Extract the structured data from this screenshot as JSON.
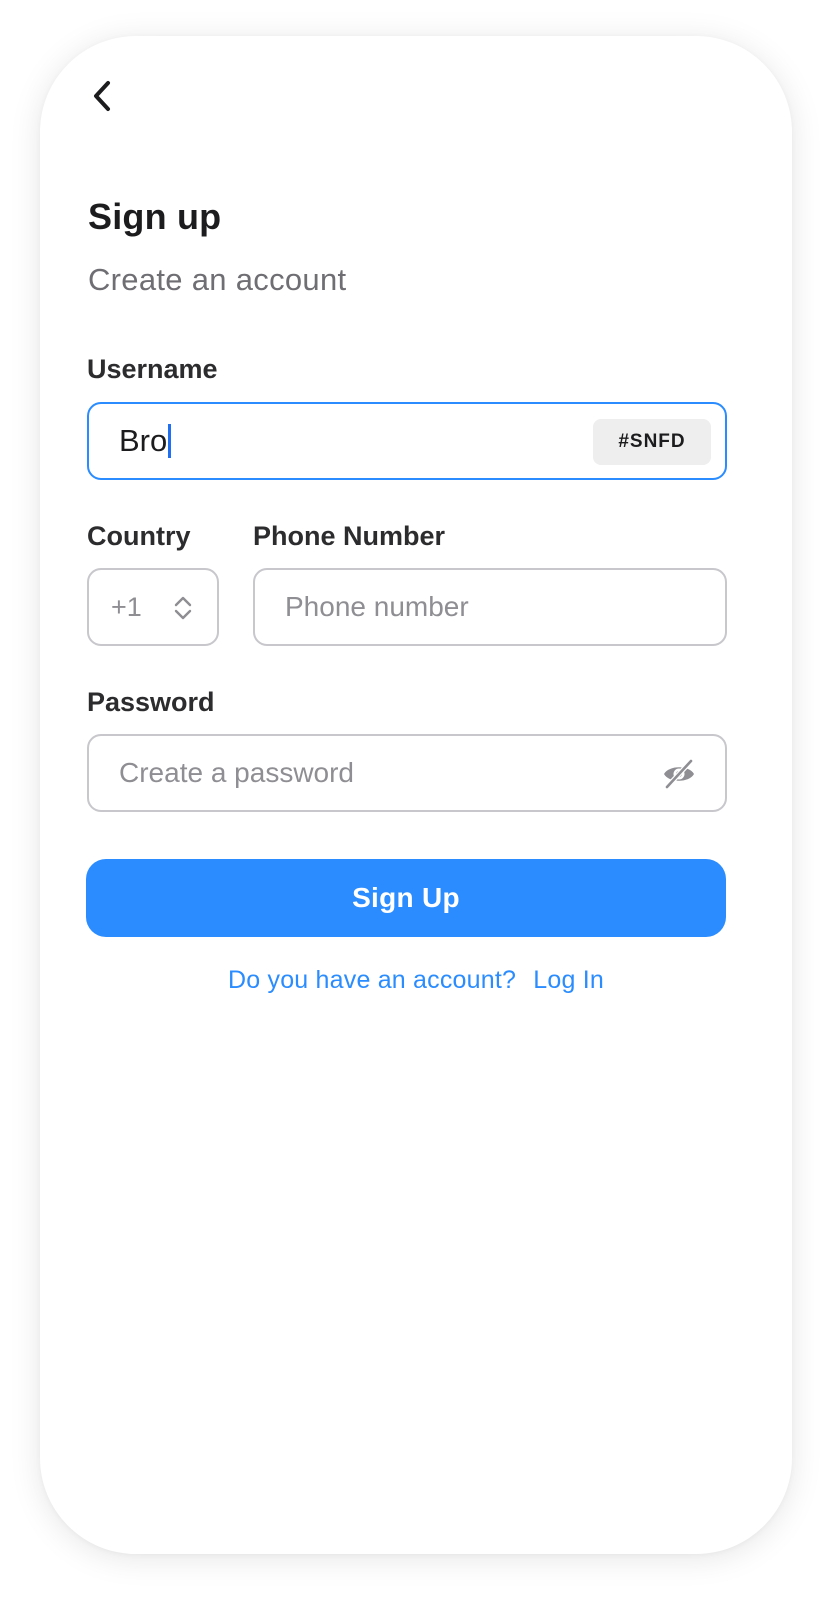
{
  "header": {
    "back_icon": "chevron-left-icon",
    "title": "Sign up",
    "subtitle": "Create an account"
  },
  "form": {
    "username": {
      "label": "Username",
      "value": "Bro",
      "tag": "#SNFD"
    },
    "country": {
      "label": "Country",
      "value": "+1",
      "icon": "chevron-up-down-icon"
    },
    "phone": {
      "label": "Phone Number",
      "placeholder": "Phone number"
    },
    "password": {
      "label": "Password",
      "placeholder": "Create a password",
      "icon": "eye-off-icon"
    }
  },
  "actions": {
    "signup_label": "Sign Up",
    "login_prompt": "Do you have an account?",
    "login_label": "Log In"
  },
  "colors": {
    "accent": "#2a8cff",
    "focus_border": "#2a8cff",
    "text_primary": "#1c1c1e",
    "text_secondary": "#6e6e73",
    "placeholder": "#8e8e93"
  }
}
